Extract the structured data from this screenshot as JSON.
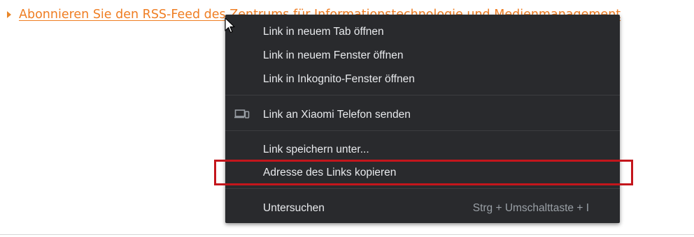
{
  "page": {
    "rss_link_text": "Abonnieren Sie den RSS-Feed des Zentrums für Informationstechnologie und Medienmanagement",
    "link_color": "#ef7d22"
  },
  "context_menu": {
    "background": "#292a2d",
    "items": [
      {
        "label": "Link in neuem Tab öffnen"
      },
      {
        "label": "Link in neuem Fenster öffnen"
      },
      {
        "label": "Link in Inkognito-Fenster öffnen"
      },
      {
        "label": "Link an Xiaomi Telefon senden",
        "icon": "devices-icon"
      },
      {
        "label": "Link speichern unter..."
      },
      {
        "label": "Adresse des Links kopieren",
        "highlighted": true
      },
      {
        "label": "Untersuchen",
        "shortcut": "Strg + Umschalttaste + I"
      }
    ]
  },
  "annotation": {
    "highlight_color": "#c4161c"
  }
}
